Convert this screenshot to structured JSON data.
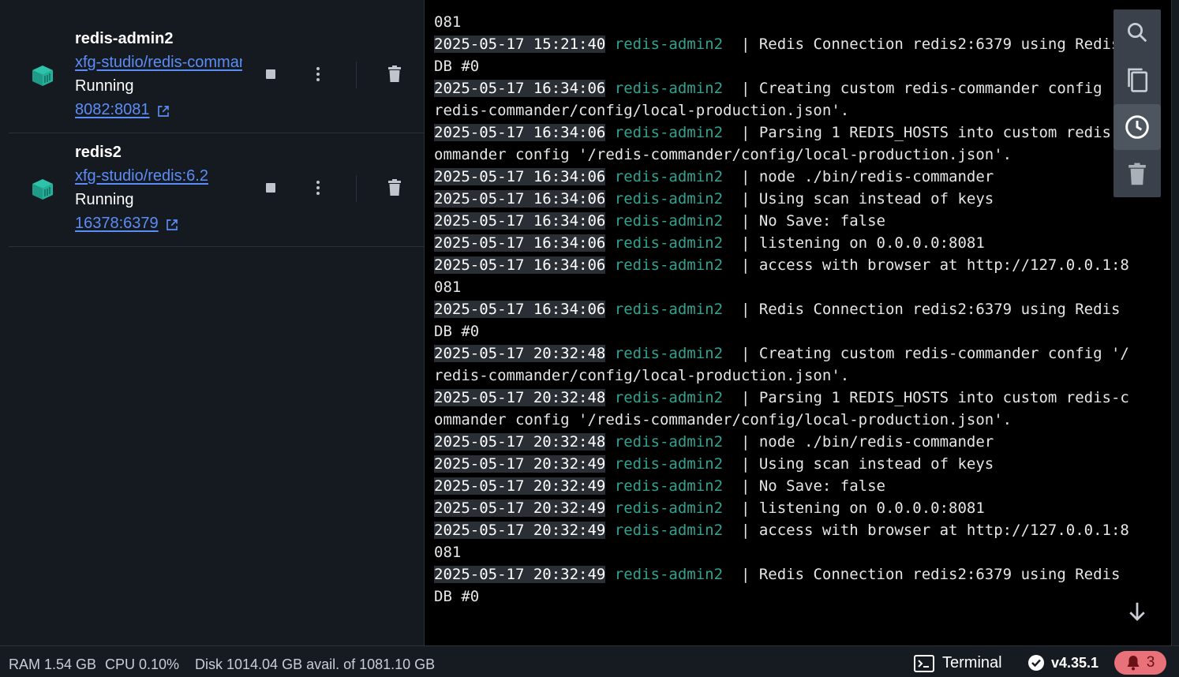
{
  "containers": [
    {
      "name": "redis-admin2",
      "image": "xfg-studio/redis-commander",
      "status": "Running",
      "port": "8082:8081"
    },
    {
      "name": "redis2",
      "image": "xfg-studio/redis:6.2",
      "status": "Running",
      "port": "16378:6379"
    }
  ],
  "logs": [
    {
      "ts": "",
      "svc": "",
      "msg": "081"
    },
    {
      "ts": "2025-05-17 15:21:40",
      "svc": "redis-admin2",
      "msg": "  | Redis Connection redis2:6379 using Redis"
    },
    {
      "ts": "",
      "svc": "",
      "msg": "DB #0"
    },
    {
      "ts": "2025-05-17 16:34:06",
      "svc": "redis-admin2",
      "msg": "  | Creating custom redis-commander config '/"
    },
    {
      "ts": "",
      "svc": "",
      "msg": "redis-commander/config/local-production.json'."
    },
    {
      "ts": "2025-05-17 16:34:06",
      "svc": "redis-admin2",
      "msg": "  | Parsing 1 REDIS_HOSTS into custom redis-c"
    },
    {
      "ts": "",
      "svc": "",
      "msg": "ommander config '/redis-commander/config/local-production.json'."
    },
    {
      "ts": "2025-05-17 16:34:06",
      "svc": "redis-admin2",
      "msg": "  | node ./bin/redis-commander"
    },
    {
      "ts": "2025-05-17 16:34:06",
      "svc": "redis-admin2",
      "msg": "  | Using scan instead of keys"
    },
    {
      "ts": "2025-05-17 16:34:06",
      "svc": "redis-admin2",
      "msg": "  | No Save: false"
    },
    {
      "ts": "2025-05-17 16:34:06",
      "svc": "redis-admin2",
      "msg": "  | listening on 0.0.0.0:8081"
    },
    {
      "ts": "2025-05-17 16:34:06",
      "svc": "redis-admin2",
      "msg": "  | access with browser at http://127.0.0.1:8"
    },
    {
      "ts": "",
      "svc": "",
      "msg": "081"
    },
    {
      "ts": "2025-05-17 16:34:06",
      "svc": "redis-admin2",
      "msg": "  | Redis Connection redis2:6379 using Redis"
    },
    {
      "ts": "",
      "svc": "",
      "msg": "DB #0"
    },
    {
      "ts": "2025-05-17 20:32:48",
      "svc": "redis-admin2",
      "msg": "  | Creating custom redis-commander config '/"
    },
    {
      "ts": "",
      "svc": "",
      "msg": "redis-commander/config/local-production.json'."
    },
    {
      "ts": "2025-05-17 20:32:48",
      "svc": "redis-admin2",
      "msg": "  | Parsing 1 REDIS_HOSTS into custom redis-c"
    },
    {
      "ts": "",
      "svc": "",
      "msg": "ommander config '/redis-commander/config/local-production.json'."
    },
    {
      "ts": "2025-05-17 20:32:48",
      "svc": "redis-admin2",
      "msg": "  | node ./bin/redis-commander"
    },
    {
      "ts": "2025-05-17 20:32:49",
      "svc": "redis-admin2",
      "msg": "  | Using scan instead of keys"
    },
    {
      "ts": "2025-05-17 20:32:49",
      "svc": "redis-admin2",
      "msg": "  | No Save: false"
    },
    {
      "ts": "2025-05-17 20:32:49",
      "svc": "redis-admin2",
      "msg": "  | listening on 0.0.0.0:8081"
    },
    {
      "ts": "2025-05-17 20:32:49",
      "svc": "redis-admin2",
      "msg": "  | access with browser at http://127.0.0.1:8"
    },
    {
      "ts": "",
      "svc": "",
      "msg": "081"
    },
    {
      "ts": "2025-05-17 20:32:49",
      "svc": "redis-admin2",
      "msg": "  | Redis Connection redis2:6379 using Redis"
    },
    {
      "ts": "",
      "svc": "",
      "msg": "DB #0"
    }
  ],
  "toolbar": {
    "icons": [
      "search-icon",
      "copy-icon",
      "clock-icon",
      "trash-icon"
    ],
    "active": "clock-icon"
  },
  "status_bar": {
    "ram": "RAM 1.54 GB",
    "cpu": "CPU 0.10%",
    "disk": "Disk 1014.04 GB avail. of 1081.10 GB",
    "terminal": "Terminal",
    "version": "v4.35.1",
    "notifications": "3"
  },
  "colors": {
    "accent": "#5b8df6",
    "service": "#2fa391",
    "notif_bg": "#e8717a",
    "cube": "#23b19a"
  }
}
